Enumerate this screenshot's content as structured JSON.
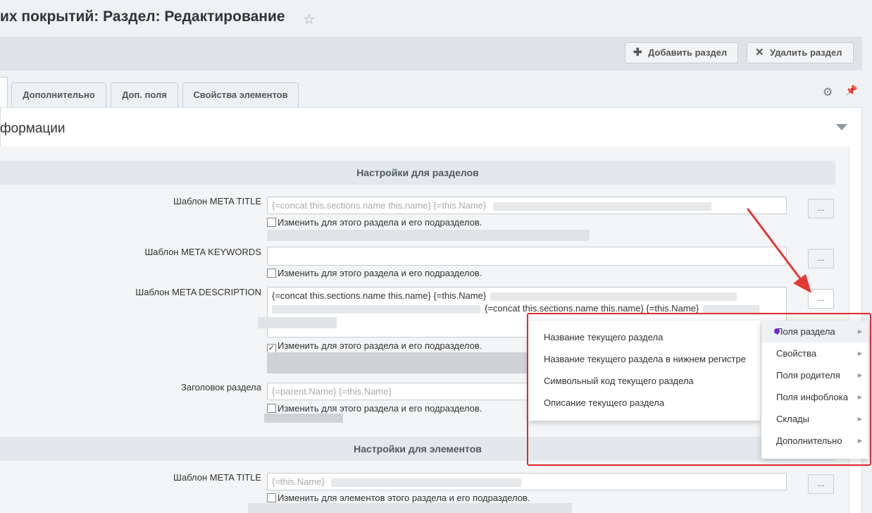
{
  "page": {
    "title": "их покрытий: Раздел: Редактирование",
    "star_icon": "☆"
  },
  "toolbar": {
    "add_section": "Добавить раздел",
    "delete_section": "Удалить раздел"
  },
  "tabs": [
    "Дополнительно",
    "Доп. поля",
    "Свойства элементов"
  ],
  "section": {
    "title": "формации"
  },
  "sections_settings": {
    "header": "Настройки для разделов",
    "meta_title_label": "Шаблон META TITLE",
    "meta_title_value": "{=concat this.sections.name this.name} {=this.Name}",
    "meta_title_check": "Изменить для этого раздела и его подразделов.",
    "meta_keywords_label": "Шаблон META KEYWORDS",
    "meta_keywords_check": "Изменить для этого раздела и его подразделов.",
    "meta_description_label": "Шаблон META DESCRIPTION",
    "meta_description_value_line1": "{=concat this.sections.name this.name} {=this.Name}",
    "meta_description_value_line2": "{=concat this.sections.name this.name} {=this.Name}",
    "meta_description_check": "Изменить для этого раздела и его подразделов.",
    "heading_label": "Заголовок раздела",
    "heading_value": "{=parent.Name} {=this.Name}",
    "heading_check": "Изменить для этого раздела и его подразделов."
  },
  "elements_settings": {
    "header": "Настройки для элементов",
    "meta_title_label": "Шаблон META TITLE",
    "meta_title_value": "{=this.Name}",
    "meta_title_check": "Изменить для элементов этого раздела и его подразделов."
  },
  "dots_label": "...",
  "menu_left": [
    "Название текущего раздела",
    "Название текущего раздела в нижнем регистре",
    "Символьный код текущего раздела",
    "Описание текущего раздела"
  ],
  "menu_right": [
    "Поля раздела",
    "Свойства",
    "Поля родителя",
    "Поля инфоблока",
    "Склады",
    "Дополнительно"
  ],
  "colors": {
    "highlight_border": "#e02a2a",
    "arrow": "#e53935"
  }
}
